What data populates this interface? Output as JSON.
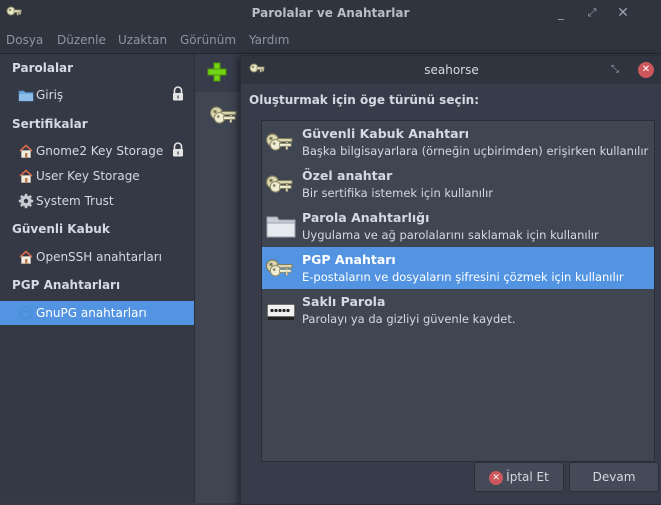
{
  "window": {
    "title": "Parolalar ve Anahtarlar"
  },
  "menu": [
    "Dosya",
    "Düzenle",
    "Uzaktan",
    "Görünüm",
    "Yardım"
  ],
  "sidebar": {
    "sections": [
      {
        "title": "Parolalar",
        "items": [
          {
            "label": "Giriş",
            "icon": "folder-icon",
            "locked": true
          }
        ]
      },
      {
        "title": "Sertifikalar",
        "items": [
          {
            "label": "Gnome2 Key Storage",
            "icon": "home-icon",
            "locked": true
          },
          {
            "label": "User Key Storage",
            "icon": "home-icon"
          },
          {
            "label": "System Trust",
            "icon": "gear-icon"
          }
        ]
      },
      {
        "title": "Güvenli Kabuk",
        "items": [
          {
            "label": "OpenSSH anahtarları",
            "icon": "home-icon"
          }
        ]
      },
      {
        "title": "PGP Anahtarları",
        "items": [
          {
            "label": "GnuPG anahtarları",
            "icon": "gnupg-icon",
            "selected": true
          }
        ]
      }
    ]
  },
  "dialog": {
    "title": "seahorse",
    "prompt": "Oluşturmak için öge türünü seçin:",
    "options": [
      {
        "name": "Güvenli Kabuk Anahtarı",
        "description": "Başka bilgisayarlara (örneğin uçbirimden) erişirken kullanılır",
        "icon": "keys-icon"
      },
      {
        "name": "Özel anahtar",
        "description": "Bir sertifika istemek için kullanılır",
        "icon": "keys-icon"
      },
      {
        "name": "Parola Anahtarlığı",
        "description": "Uygulama ve ağ parolalarını saklamak için kullanılır",
        "icon": "folder-icon"
      },
      {
        "name": "PGP Anahtarı",
        "description": "E-postaların ve dosyaların şifresini çözmek için kullanılır",
        "icon": "keys-icon",
        "selected": true
      },
      {
        "name": "Saklı Parola",
        "description": "Parolayı ya da gizliyi güvenle kaydet.",
        "icon": "password-field-icon"
      }
    ],
    "cancel_label": "İptal Et",
    "continue_label": "Devam"
  },
  "colors": {
    "accent": "#5294e2",
    "add": "#73d216",
    "close": "#cc575d"
  }
}
